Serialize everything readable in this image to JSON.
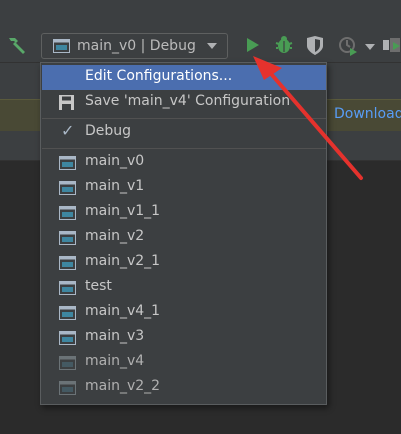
{
  "toolbar": {
    "run_config_label": "main_v0 | Debug"
  },
  "banner": {
    "link_text": "Download"
  },
  "menu": {
    "edit_configurations": "Edit Configurations...",
    "save_configuration": "Save 'main_v4' Configuration",
    "debug": "Debug",
    "configurations": [
      {
        "label": "main_v0"
      },
      {
        "label": "main_v1"
      },
      {
        "label": "main_v1_1"
      },
      {
        "label": "main_v2"
      },
      {
        "label": "main_v2_1"
      },
      {
        "label": "test"
      },
      {
        "label": "main_v4_1"
      },
      {
        "label": "main_v3"
      },
      {
        "label": "main_v4"
      },
      {
        "label": "main_v2_2"
      }
    ]
  },
  "colors": {
    "accent_selection": "#4b6eaf",
    "run_green": "#499c54",
    "annotation_red": "#e5322d"
  }
}
